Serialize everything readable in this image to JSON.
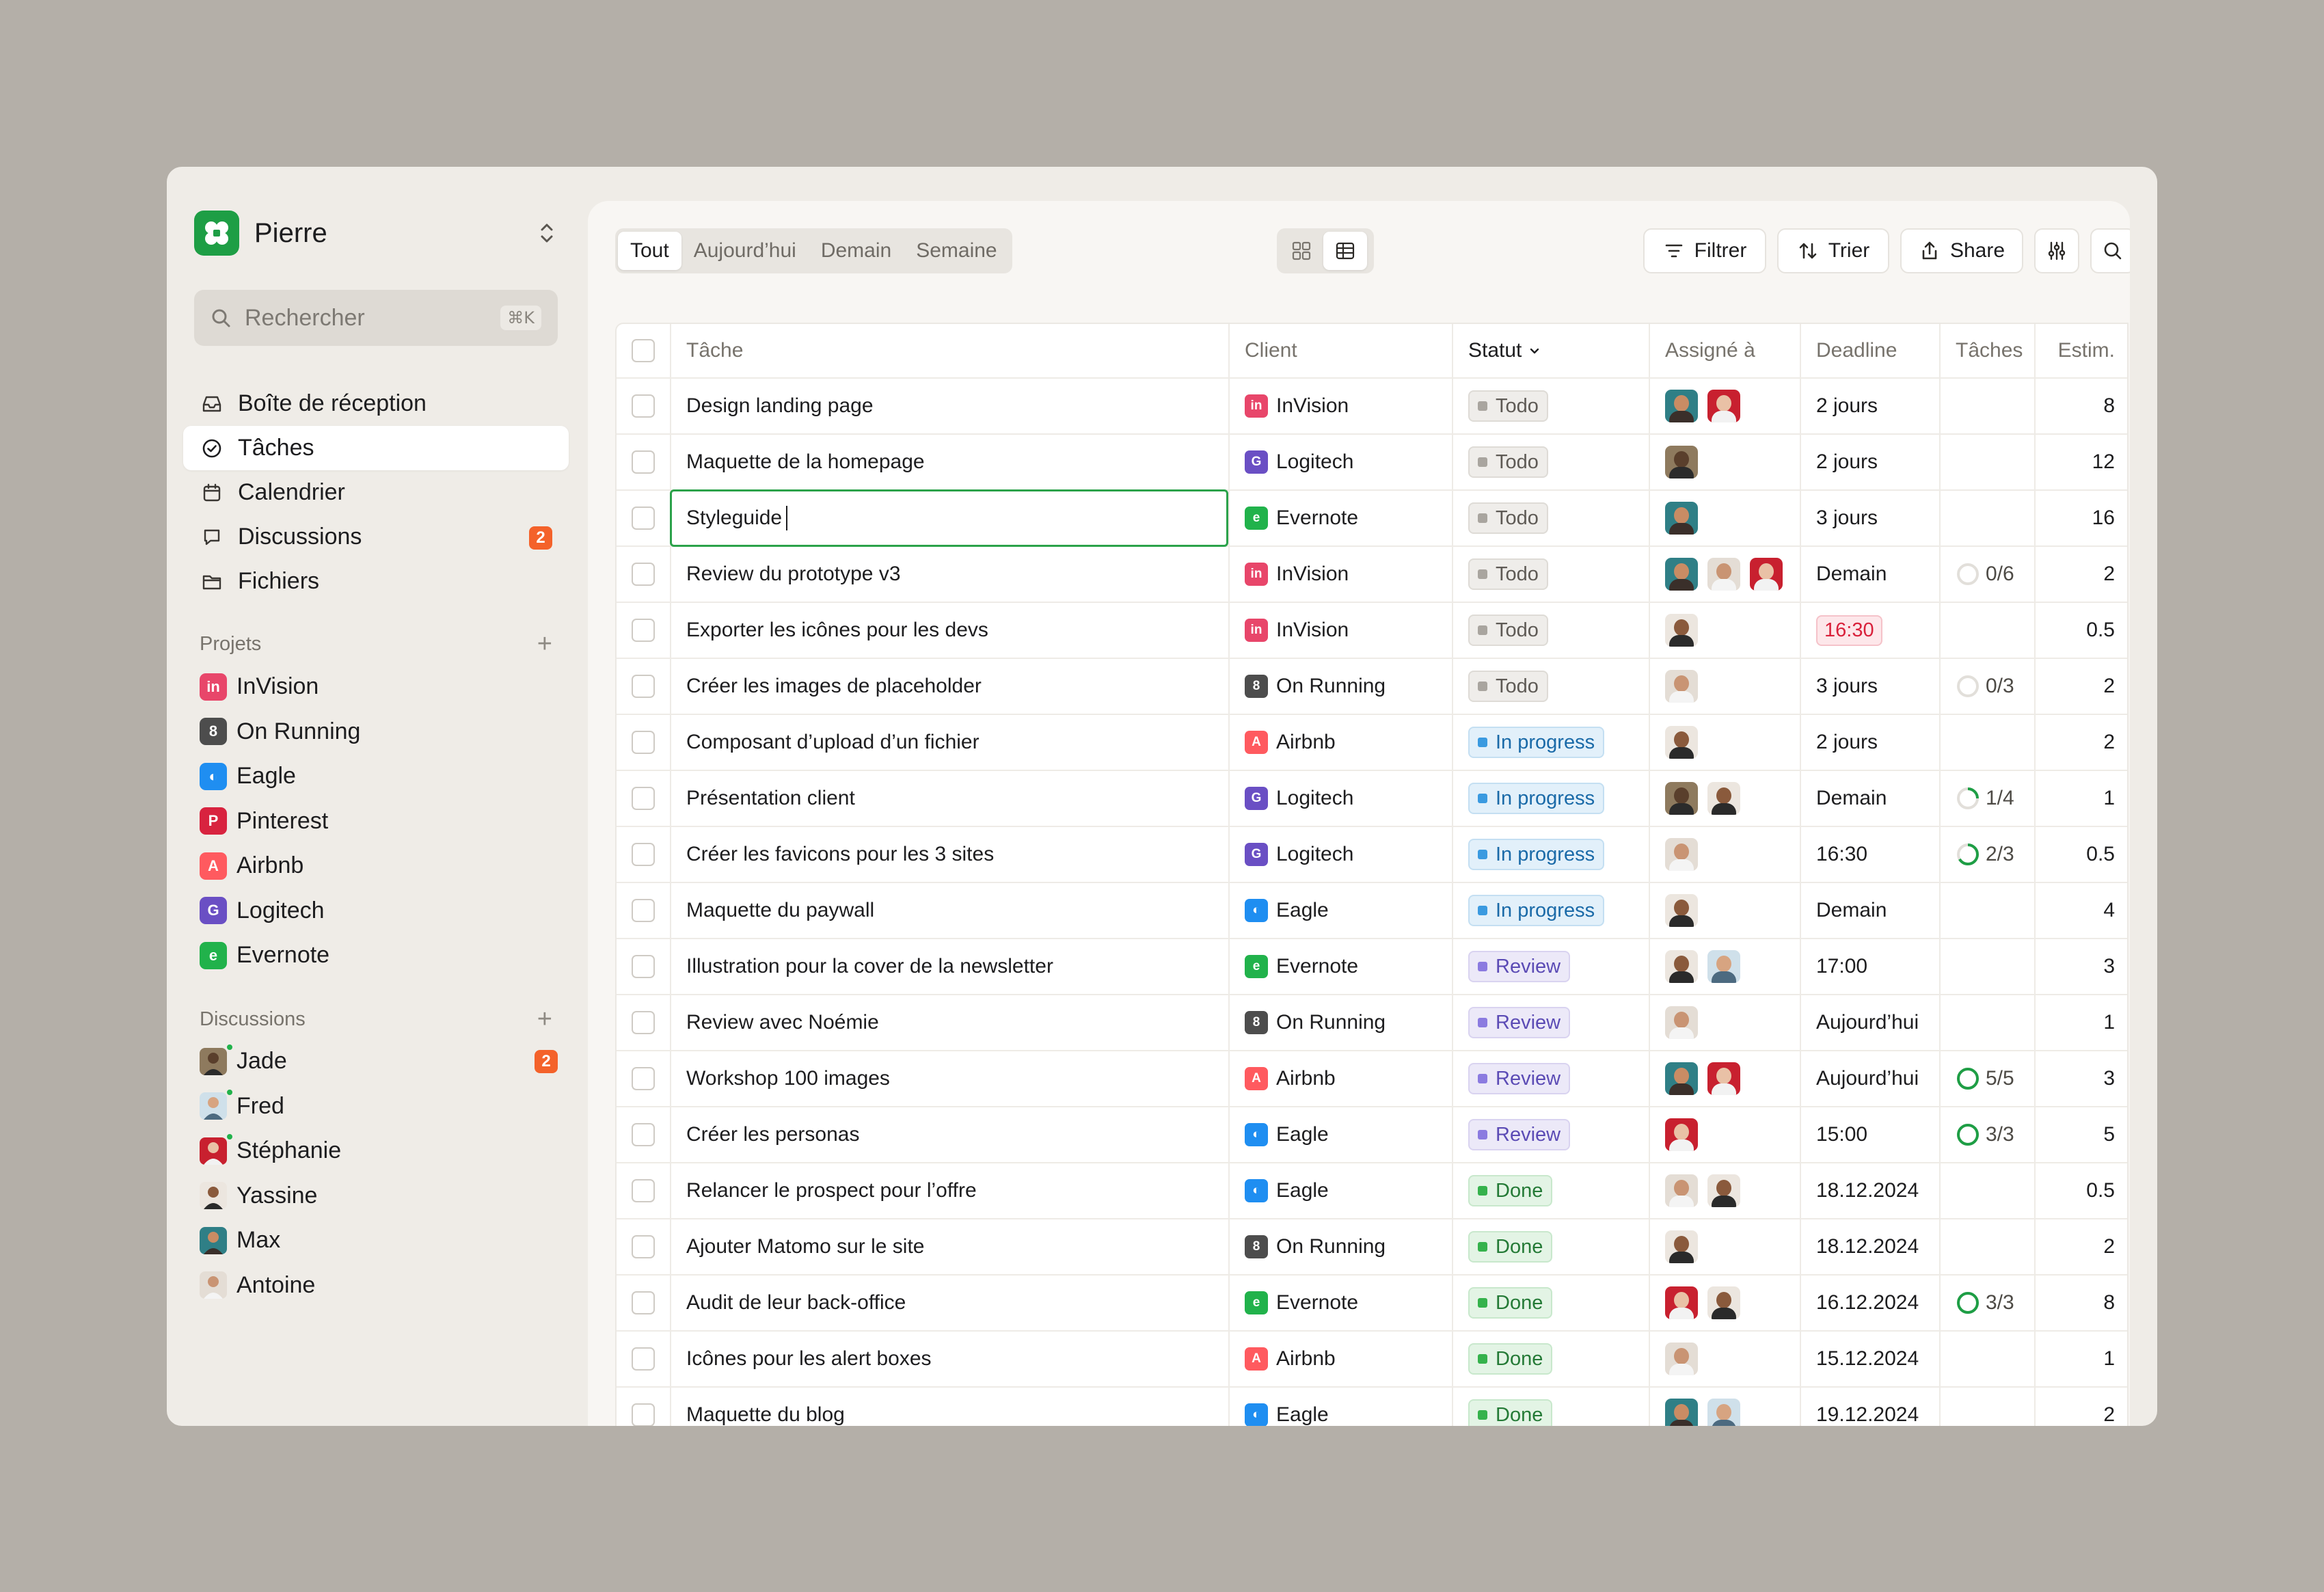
{
  "workspace": {
    "name": "Pierre"
  },
  "search": {
    "placeholder": "Rechercher",
    "shortcut": "⌘K"
  },
  "nav": [
    {
      "label": "Boîte de réception",
      "icon": "inbox-icon"
    },
    {
      "label": "Tâches",
      "icon": "check-circle-icon",
      "active": true
    },
    {
      "label": "Calendrier",
      "icon": "calendar-icon"
    },
    {
      "label": "Discussions",
      "icon": "chat-icon",
      "badge": "2"
    },
    {
      "label": "Fichiers",
      "icon": "folder-icon"
    }
  ],
  "projects": {
    "title": "Projets",
    "items": [
      {
        "label": "InVision",
        "icon": "invision-icon",
        "color": "#e8466a"
      },
      {
        "label": "On Running",
        "icon": "on-running-icon",
        "color": "#4d4d4d"
      },
      {
        "label": "Eagle",
        "icon": "eagle-icon",
        "color": "#1f8ef1"
      },
      {
        "label": "Pinterest",
        "icon": "pinterest-icon",
        "color": "#d8233f"
      },
      {
        "label": "Airbnb",
        "icon": "airbnb-icon",
        "color": "#ff5a5f"
      },
      {
        "label": "Logitech",
        "icon": "logitech-icon",
        "color": "#6a4fc4"
      },
      {
        "label": "Evernote",
        "icon": "evernote-icon",
        "color": "#21b24b"
      }
    ]
  },
  "discussions": {
    "title": "Discussions",
    "items": [
      {
        "label": "Jade",
        "badge": "2",
        "online": true
      },
      {
        "label": "Fred",
        "online": true
      },
      {
        "label": "Stéphanie",
        "online": true
      },
      {
        "label": "Yassine"
      },
      {
        "label": "Max"
      },
      {
        "label": "Antoine"
      }
    ]
  },
  "filters": {
    "tabs": [
      "Tout",
      "Aujourd’hui",
      "Demain",
      "Semaine"
    ],
    "active": "Tout"
  },
  "toolbar": {
    "filter": "Filtrer",
    "sort": "Trier",
    "share": "Share"
  },
  "table": {
    "headers": [
      "Tâche",
      "Client",
      "Statut",
      "Assigné à",
      "Deadline",
      "Tâches",
      "Estim."
    ],
    "rows": [
      {
        "task": "Design landing page",
        "client": "InVision",
        "status": "Todo",
        "assignees": [
          "Max",
          "Stéphanie"
        ],
        "deadline": "2 jours",
        "tasks": "",
        "estim": "8"
      },
      {
        "task": "Maquette de la homepage",
        "client": "Logitech",
        "status": "Todo",
        "assignees": [
          "Jade"
        ],
        "deadline": "2 jours",
        "tasks": "",
        "estim": "12"
      },
      {
        "task": "Styleguide",
        "client": "Evernote",
        "status": "Todo",
        "assignees": [
          "Max"
        ],
        "deadline": "3 jours",
        "tasks": "",
        "estim": "16",
        "editing": true
      },
      {
        "task": "Review du prototype v3",
        "client": "InVision",
        "status": "Todo",
        "assignees": [
          "Max",
          "Antoine",
          "Stéphanie"
        ],
        "deadline": "Demain",
        "tasks": "0/6",
        "estim": "2"
      },
      {
        "task": "Exporter les icônes pour les devs",
        "client": "InVision",
        "status": "Todo",
        "assignees": [
          "Yassine"
        ],
        "deadline": "16:30",
        "deadline_alert": true,
        "tasks": "",
        "estim": "0.5"
      },
      {
        "task": "Créer les images de placeholder",
        "client": "On Running",
        "status": "Todo",
        "assignees": [
          "Antoine"
        ],
        "deadline": "3 jours",
        "tasks": "0/3",
        "estim": "2"
      },
      {
        "task": "Composant d’upload d’un fichier",
        "client": "Airbnb",
        "status": "In progress",
        "assignees": [
          "Yassine"
        ],
        "deadline": "2 jours",
        "tasks": "",
        "estim": "2"
      },
      {
        "task": "Présentation client",
        "client": "Logitech",
        "status": "In progress",
        "assignees": [
          "Jade",
          "Yassine"
        ],
        "deadline": "Demain",
        "tasks": "1/4",
        "estim": "1"
      },
      {
        "task": "Créer les favicons pour les 3 sites",
        "client": "Logitech",
        "status": "In progress",
        "assignees": [
          "Antoine"
        ],
        "deadline": "16:30",
        "tasks": "2/3",
        "estim": "0.5"
      },
      {
        "task": "Maquette du paywall",
        "client": "Eagle",
        "status": "In progress",
        "assignees": [
          "Yassine"
        ],
        "deadline": "Demain",
        "tasks": "",
        "estim": "4"
      },
      {
        "task": "Illustration pour la cover de la newsletter",
        "client": "Evernote",
        "status": "Review",
        "assignees": [
          "Yassine",
          "Fred"
        ],
        "deadline": "17:00",
        "tasks": "",
        "estim": "3"
      },
      {
        "task": "Review avec Noémie",
        "client": "On Running",
        "status": "Review",
        "assignees": [
          "Antoine"
        ],
        "deadline": "Aujourd’hui",
        "tasks": "",
        "estim": "1"
      },
      {
        "task": "Workshop 100 images",
        "client": "Airbnb",
        "status": "Review",
        "assignees": [
          "Max",
          "Stéphanie"
        ],
        "deadline": "Aujourd’hui",
        "tasks": "5/5",
        "estim": "3"
      },
      {
        "task": "Créer les personas",
        "client": "Eagle",
        "status": "Review",
        "assignees": [
          "Stéphanie"
        ],
        "deadline": "15:00",
        "tasks": "3/3",
        "estim": "5"
      },
      {
        "task": "Relancer le prospect pour l’offre",
        "client": "Eagle",
        "status": "Done",
        "assignees": [
          "Antoine",
          "Yassine"
        ],
        "deadline": "18.12.2024",
        "tasks": "",
        "estim": "0.5"
      },
      {
        "task": "Ajouter Matomo sur le site",
        "client": "On Running",
        "status": "Done",
        "assignees": [
          "Yassine"
        ],
        "deadline": "18.12.2024",
        "tasks": "",
        "estim": "2"
      },
      {
        "task": "Audit de leur back-office",
        "client": "Evernote",
        "status": "Done",
        "assignees": [
          "Stéphanie",
          "Yassine"
        ],
        "deadline": "16.12.2024",
        "tasks": "3/3",
        "estim": "8"
      },
      {
        "task": "Icônes pour les alert boxes",
        "client": "Airbnb",
        "status": "Done",
        "assignees": [
          "Antoine"
        ],
        "deadline": "15.12.2024",
        "tasks": "",
        "estim": "1"
      },
      {
        "task": "Maquette du blog",
        "client": "Eagle",
        "status": "Done",
        "assignees": [
          "Max",
          "Fred"
        ],
        "deadline": "19.12.2024",
        "tasks": "",
        "estim": "2"
      }
    ]
  },
  "colors": {
    "accent": "#1e9e45",
    "badge": "#f4622a",
    "alert": "#d9213b"
  }
}
